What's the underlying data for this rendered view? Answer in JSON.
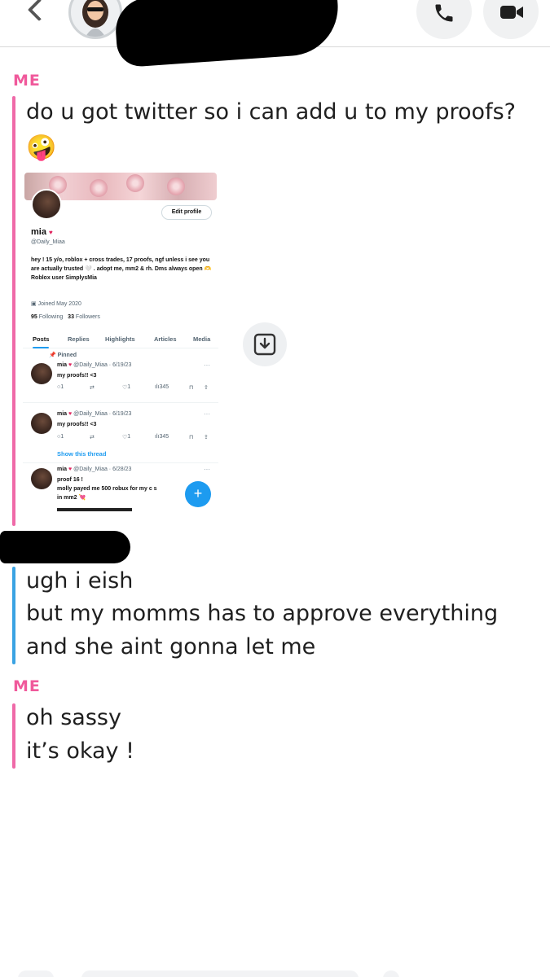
{
  "header": {
    "back_icon": "chevron-left-icon",
    "call_icon": "phone-icon",
    "video_icon": "video-camera-icon"
  },
  "messages": [
    {
      "sender": "ME",
      "lines": [
        "do u got twitter so i can add u to my proofs?"
      ],
      "emoji": "🤪"
    },
    {
      "sender": "",
      "lines": [
        "ugh i eish",
        "but my momms has to approve everything",
        "and she aint gonna let me"
      ]
    },
    {
      "sender": "ME",
      "lines": [
        "oh sassy",
        "it’s okay !"
      ]
    }
  ],
  "shot": {
    "edit_profile": "Edit profile",
    "name": "mia",
    "heart": "♥",
    "handle": "@Daily_Miaa",
    "bio": "hey ! 15 y/o, roblox + cross trades, 17 proofs, ngf unless i see you are actually trusted 🤍 . adopt me, mm2 & rh. Dms always open 🫶 Roblox user SimplysMia",
    "joined": "Joined May 2020",
    "following_count": "95",
    "following_label": "Following",
    "followers_count": "33",
    "followers_label": "Followers",
    "tabs": [
      "Posts",
      "Replies",
      "Highlights",
      "Articles",
      "Media"
    ],
    "pinned_label": "Pinned",
    "tweets": [
      {
        "name": "mia",
        "meta": "@Daily_Miaa · 6/19/23",
        "text": [
          "my proofs!! <3"
        ],
        "reply": "1",
        "like": "1",
        "views": "345"
      },
      {
        "name": "mia",
        "meta": "@Daily_Miaa · 6/19/23",
        "text": [
          "my proofs!! <3"
        ],
        "reply": "1",
        "like": "1",
        "views": "345"
      },
      {
        "name": "mia",
        "meta": "@Daily_Miaa · 6/28/23",
        "text": [
          "proof 16 !",
          "molly payed me 500 robux for my c s",
          "in mm2 💘"
        ]
      }
    ],
    "show_thread": "Show this thread",
    "fab": "+"
  },
  "save_icon": "save-to-camera-roll-icon"
}
